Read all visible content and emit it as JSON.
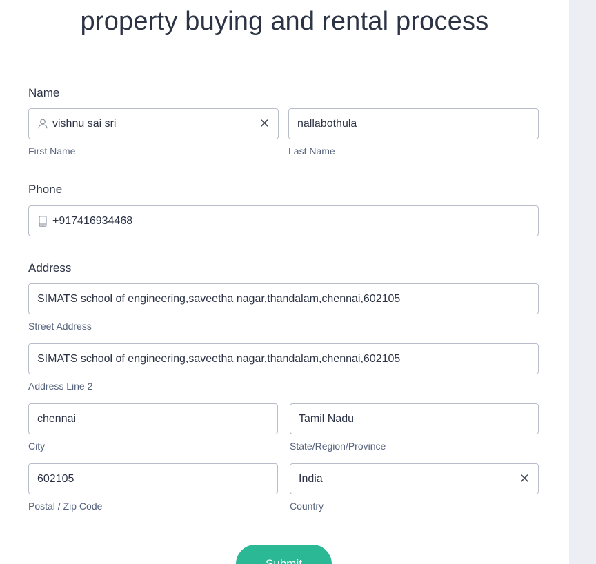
{
  "form": {
    "title": "property buying and rental process",
    "submit_label": "Submit"
  },
  "name": {
    "label": "Name",
    "first_name": {
      "value": "vishnu sai sri",
      "sublabel": "First Name",
      "icon": "user-icon"
    },
    "last_name": {
      "value": "nallabothula",
      "sublabel": "Last Name"
    }
  },
  "phone": {
    "label": "Phone",
    "value": "+917416934468",
    "icon": "mobile-phone-icon"
  },
  "address": {
    "label": "Address",
    "street": {
      "value": "SIMATS school of engineering,saveetha nagar,thandalam,chennai,602105",
      "sublabel": "Street Address"
    },
    "line2": {
      "value": "SIMATS school of engineering,saveetha nagar,thandalam,chennai,602105",
      "sublabel": "Address Line 2"
    },
    "city": {
      "value": "chennai",
      "sublabel": "City"
    },
    "state": {
      "value": "Tamil Nadu",
      "sublabel": "State/Region/Province"
    },
    "zip": {
      "value": "602105",
      "sublabel": "Postal / Zip Code"
    },
    "country": {
      "value": "India",
      "sublabel": "Country"
    }
  },
  "colors": {
    "accent": "#2bb894",
    "border": "#b8bdc9",
    "text": "#2c3345",
    "gutter": "#eceef4"
  }
}
